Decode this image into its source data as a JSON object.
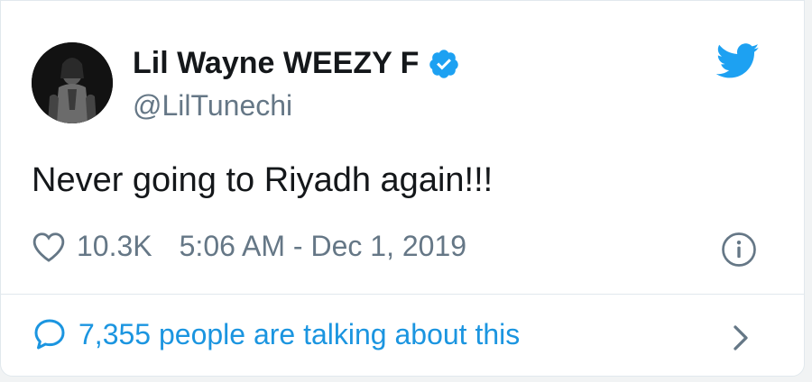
{
  "tweet": {
    "author_name": "Lil Wayne WEEZY F",
    "handle": "@LilTunechi",
    "text": "Never going to Riyadh again!!!",
    "likes": "10.3K",
    "timestamp": "5:06 AM - Dec 1, 2019",
    "talking": "7,355 people are talking about this"
  },
  "icons": {
    "verified": "verified-badge-icon",
    "brand": "twitter-bird-icon",
    "like": "heart-icon",
    "info": "info-icon",
    "reply": "speech-bubble-icon",
    "more": "chevron-right-icon"
  },
  "colors": {
    "brand_blue": "#1da1f2",
    "link_blue": "#1b95e0",
    "text_dark": "#14171a",
    "text_gray": "#657786"
  }
}
